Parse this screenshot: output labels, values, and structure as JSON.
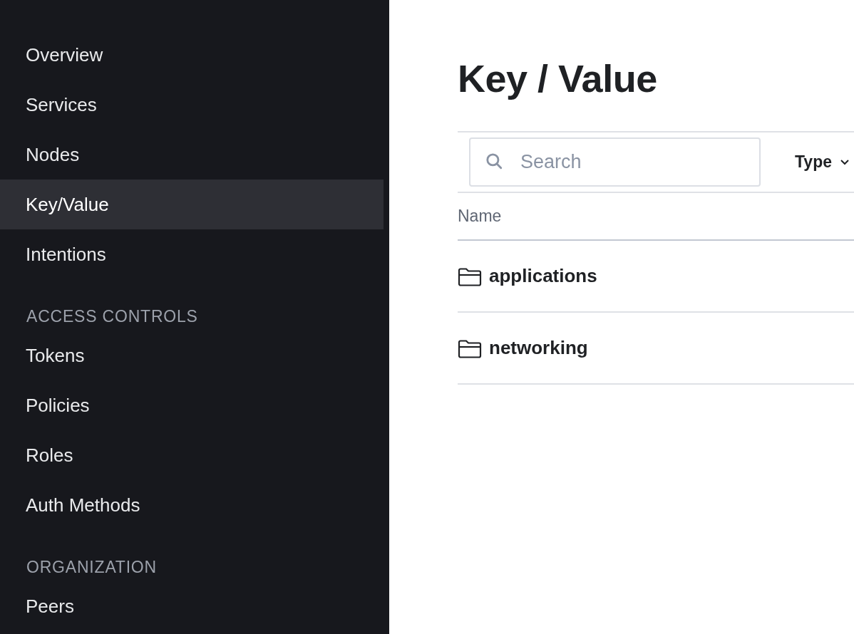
{
  "sidebar": {
    "sections": [
      {
        "items": [
          {
            "label": "Overview",
            "selected": false
          },
          {
            "label": "Services",
            "selected": false
          },
          {
            "label": "Nodes",
            "selected": false
          },
          {
            "label": "Key/Value",
            "selected": true
          },
          {
            "label": "Intentions",
            "selected": false
          }
        ]
      },
      {
        "heading": "ACCESS CONTROLS",
        "items": [
          {
            "label": "Tokens",
            "selected": false
          },
          {
            "label": "Policies",
            "selected": false
          },
          {
            "label": "Roles",
            "selected": false
          },
          {
            "label": "Auth Methods",
            "selected": false
          }
        ]
      },
      {
        "heading": "ORGANIZATION",
        "items": [
          {
            "label": "Peers",
            "selected": false
          }
        ]
      }
    ]
  },
  "page": {
    "title": "Key / Value"
  },
  "toolbar": {
    "search": {
      "placeholder": "Search"
    },
    "filter": {
      "label": "Type"
    }
  },
  "table": {
    "columns": [
      "Name"
    ],
    "rows": [
      {
        "kind": "folder",
        "name": "applications"
      },
      {
        "kind": "folder",
        "name": "networking"
      }
    ]
  }
}
